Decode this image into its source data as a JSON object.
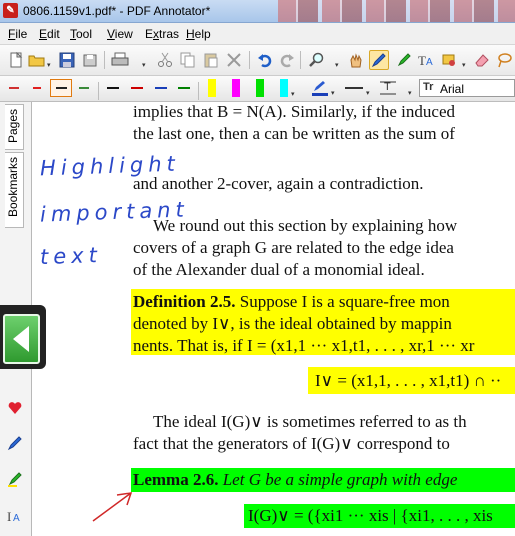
{
  "window": {
    "title": "0806.1159v1.pdf* - PDF Annotator*",
    "app_icon": "pdf-annotator-icon"
  },
  "menu": [
    "File",
    "Edit",
    "Tool",
    "View",
    "Extras",
    "Help"
  ],
  "menu_underline": [
    "F",
    "E",
    "T",
    "V",
    "x",
    "H"
  ],
  "toolbar": {
    "buttons": [
      "new-document-icon",
      "open-folder-icon",
      "save-icon",
      "save-all-icon",
      "print-icon",
      "cut-icon",
      "copy-icon",
      "paste-icon",
      "delete-icon",
      "undo-icon",
      "redo-icon",
      "zoom-icon",
      "hand-icon",
      "pen-icon",
      "highlighter-icon",
      "text-icon",
      "stamp-icon",
      "eraser-icon",
      "lasso-icon"
    ],
    "font_name": "Arial"
  },
  "pens": [
    "#d03030",
    "#e02020",
    "#ff9933",
    "#3a8a3a",
    "#111111",
    "#cc0000",
    "#1a3fb8",
    "#008000"
  ],
  "highlighters": [
    "#ffff00",
    "#ff00ff",
    "#00e000",
    "#00ffff"
  ],
  "sidepanel": {
    "tabs": [
      "Pages",
      "Bookmarks"
    ],
    "icons": [
      "heart-icon",
      "blue-pen-icon",
      "highlighter-icon",
      "text-tool-icon"
    ]
  },
  "document": {
    "lines": [
      "implies that B = N(A). Similarly, if the induced",
      "the last one, then a can be written as the sum of",
      "and another 2-cover, again a contradiction.",
      "We round out this section by explaining how",
      "covers of a graph G are related to the edge idea",
      "of the Alexander dual of a monomial ideal."
    ],
    "definition": {
      "label": "Definition 2.5.",
      "line1": " Suppose I is a square-free mon",
      "line2": "denoted by I∨, is the ideal obtained by mappin",
      "line3": "nents. That is, if I = (x1,1 ··· x1,t1, . . . , xr,1 ··· xr",
      "formula": "I∨ = (x1,1, . . . , x1,t1) ∩ ··"
    },
    "after_def": [
      "The ideal I(G)∨ is sometimes referred to as th",
      "fact that the generators of I(G)∨ correspond to"
    ],
    "lemma": {
      "label": "Lemma 2.6.",
      "text": " Let G be a simple graph with edge",
      "formula": "I(G)∨ = ({xi1 ··· xis | {xi1, . . . , xis"
    },
    "ink": [
      "Highlight",
      "important",
      "text"
    ],
    "ink_color": "#2b48c8",
    "highlight_yellow": "#ffff00",
    "highlight_green": "#00ff00"
  }
}
